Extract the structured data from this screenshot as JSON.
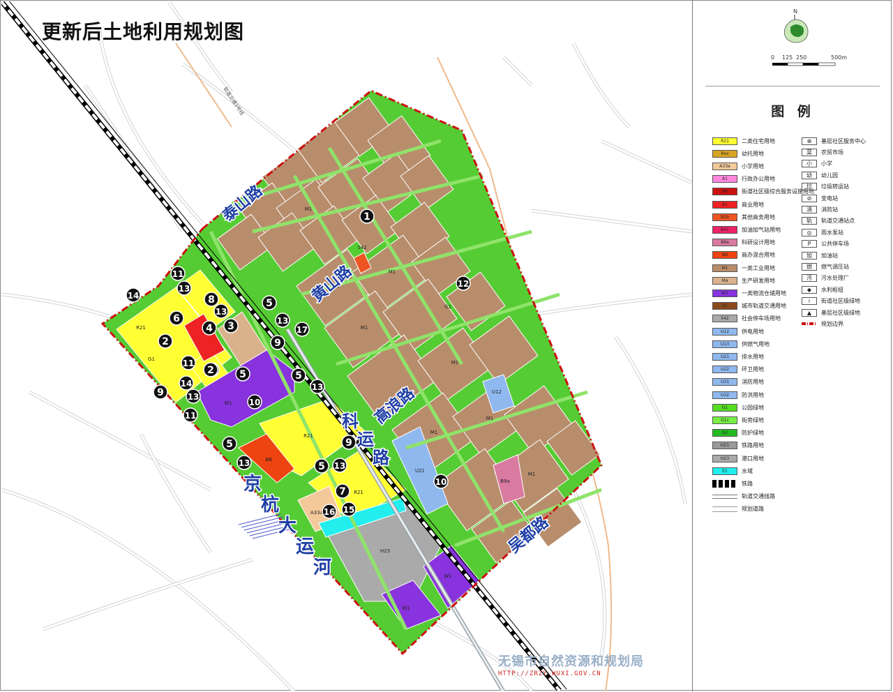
{
  "title": "更新后土地利用规划图",
  "scale": {
    "ticks": [
      "0",
      "125",
      "250",
      "500m"
    ],
    "north": "N"
  },
  "legend": {
    "heading": "图 例",
    "landuse": [
      {
        "code": "R21",
        "label": "二类住宅用地",
        "color": "#ffff33"
      },
      {
        "code": "Rxx",
        "label": "幼托用地",
        "color": "#d9a422"
      },
      {
        "code": "A33a",
        "label": "小学用地",
        "color": "#f3c99a"
      },
      {
        "code": "A1",
        "label": "行政办公用地",
        "color": "#ff88dd"
      },
      {
        "code": "A6",
        "label": "街道社区级综合服务设施用地",
        "color": "#cc1111"
      },
      {
        "code": "B1",
        "label": "商业用地",
        "color": "#ee2222"
      },
      {
        "code": "B29",
        "label": "其他商务用地",
        "color": "#ee5522"
      },
      {
        "code": "B41",
        "label": "加油加气站用地",
        "color": "#ee2266"
      },
      {
        "code": "B9a",
        "label": "科研设计用地",
        "color": "#d97aa0"
      },
      {
        "code": "BB",
        "label": "商办混合用地",
        "color": "#ee4411"
      },
      {
        "code": "M1",
        "label": "一类工业用地",
        "color": "#b88d6b"
      },
      {
        "code": "Ma",
        "label": "生产研发用地",
        "color": "#d9b28c"
      },
      {
        "code": "W1",
        "label": "一类物流仓储用地",
        "color": "#8833dd"
      },
      {
        "code": "S2",
        "label": "城市轨道交通用地",
        "color": "#8a4b1d"
      },
      {
        "code": "S42",
        "label": "社会停车场用地",
        "color": "#aaaaaa"
      },
      {
        "code": "U12",
        "label": "供电用地",
        "color": "#8fb8ee"
      },
      {
        "code": "U13",
        "label": "供燃气用地",
        "color": "#8fb8ee"
      },
      {
        "code": "U21",
        "label": "排水用地",
        "color": "#8fb8ee"
      },
      {
        "code": "U22",
        "label": "环卫用地",
        "color": "#8fb8ee"
      },
      {
        "code": "U31",
        "label": "消防用地",
        "color": "#8fb8ee"
      },
      {
        "code": "U32",
        "label": "防洪用地",
        "color": "#8fb8ee"
      },
      {
        "code": "G1",
        "label": "公园绿地",
        "color": "#55dd22"
      },
      {
        "code": "G1c",
        "label": "街旁绿地",
        "color": "#77ee44"
      },
      {
        "code": "G2",
        "label": "防护绿地",
        "color": "#22bb22"
      },
      {
        "code": "H21",
        "label": "铁路用地",
        "color": "#999999"
      },
      {
        "code": "H23",
        "label": "港口用地",
        "color": "#aaaaaa"
      },
      {
        "code": "E1",
        "label": "水域",
        "color": "#22eeee"
      }
    ],
    "lines": [
      {
        "label": "铁路",
        "style": "rail"
      },
      {
        "label": "轨道交通线路",
        "style": "transit"
      },
      {
        "label": "规划道路",
        "style": "road"
      }
    ],
    "facilities": [
      {
        "glyph": "⊕",
        "label": "基层社区服务中心"
      },
      {
        "glyph": "菜",
        "label": "农贸市场"
      },
      {
        "glyph": "小",
        "label": "小学"
      },
      {
        "glyph": "幼",
        "label": "幼儿园"
      },
      {
        "glyph": "垃",
        "label": "垃圾转运站"
      },
      {
        "glyph": "⊘",
        "label": "变电站"
      },
      {
        "glyph": "消",
        "label": "消防站"
      },
      {
        "glyph": "轨",
        "label": "轨道交通站点"
      },
      {
        "glyph": "◎",
        "label": "雨水泵站"
      },
      {
        "glyph": "P",
        "label": "公共停车场"
      },
      {
        "glyph": "加",
        "label": "加油站"
      },
      {
        "glyph": "燃",
        "label": "燃气调压站"
      },
      {
        "glyph": "污",
        "label": "污水处理厂"
      },
      {
        "glyph": "◆",
        "label": "水利枢纽"
      },
      {
        "glyph": "i",
        "label": "街道社区级绿地"
      },
      {
        "glyph": "▲",
        "label": "基层社区级绿地"
      },
      {
        "glyph": "—",
        "label": "规划边界"
      }
    ]
  },
  "roads": [
    {
      "name": "泰山路"
    },
    {
      "name": "黄山路"
    },
    {
      "name": "高浪路"
    },
    {
      "name": "科运路"
    },
    {
      "name": "吴都路"
    },
    {
      "name": "京杭大运河"
    }
  ],
  "markers": [
    "1",
    "2",
    "3",
    "4",
    "5",
    "6",
    "7",
    "8",
    "9",
    "10",
    "11",
    "12",
    "13",
    "14",
    "15",
    "16",
    "17"
  ],
  "labels": {
    "metro_line": "轨道交通3号线",
    "m1": "M1",
    "r21": "R21",
    "w1": "W1",
    "h23": "H23",
    "bb": "BB",
    "b9a": "B9a",
    "a33a": "A33a",
    "g2": "G2",
    "g1": "G1",
    "s42": "S42",
    "u12": "U12",
    "u21": "U21"
  },
  "watermark": "无锡市自然资源和规划局",
  "watermark_url": "HTTP://ZRZY.WUXI.GOV.CN"
}
